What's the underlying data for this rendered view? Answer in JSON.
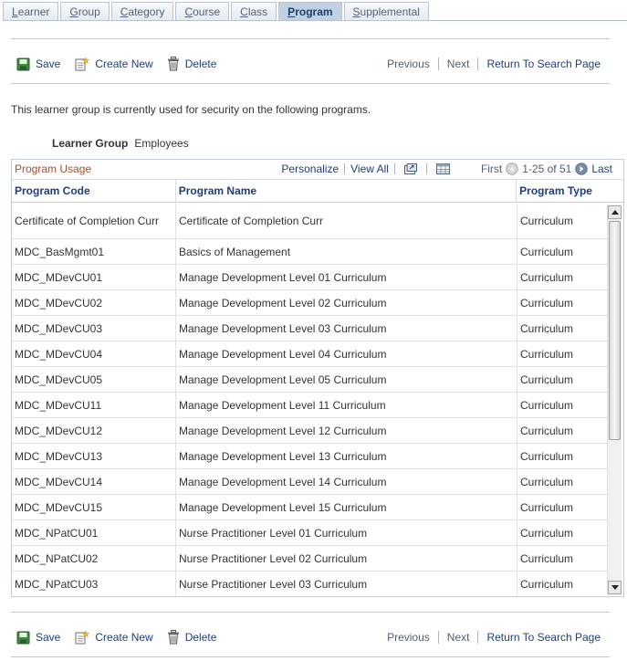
{
  "tabs": [
    {
      "label": "Learner",
      "active": false
    },
    {
      "label": "Group",
      "active": false
    },
    {
      "label": "Category",
      "active": false
    },
    {
      "label": "Course",
      "active": false
    },
    {
      "label": "Class",
      "active": false
    },
    {
      "label": "Program",
      "active": true
    },
    {
      "label": "Supplemental",
      "active": false
    }
  ],
  "toolbar": {
    "save_label": "Save",
    "create_new_label": "Create New",
    "delete_label": "Delete",
    "previous_label": "Previous",
    "next_label": "Next",
    "return_label": "Return To Search Page"
  },
  "info_text": "This learner group is currently used for security on the following programs.",
  "learner_group": {
    "label": "Learner Group",
    "value": "Employees"
  },
  "grid": {
    "title": "Program Usage",
    "personalize_label": "Personalize",
    "view_all_label": "View All",
    "first_label": "First",
    "range_label": "1-25 of 51",
    "last_label": "Last",
    "columns": [
      "Program Code",
      "Program Name",
      "Program Type"
    ],
    "rows": [
      {
        "code": "Certificate of Completion Curr",
        "name": "Certificate of Completion Curr",
        "type": "Curriculum"
      },
      {
        "code": "MDC_BasMgmt01",
        "name": "Basics of Management",
        "type": "Curriculum"
      },
      {
        "code": "MDC_MDevCU01",
        "name": "Manage Development  Level 01 Curriculum",
        "type": "Curriculum"
      },
      {
        "code": "MDC_MDevCU02",
        "name": "Manage Development  Level 02 Curriculum",
        "type": "Curriculum"
      },
      {
        "code": "MDC_MDevCU03",
        "name": "Manage Development  Level 03 Curriculum",
        "type": "Curriculum"
      },
      {
        "code": "MDC_MDevCU04",
        "name": "Manage Development  Level 04 Curriculum",
        "type": "Curriculum"
      },
      {
        "code": "MDC_MDevCU05",
        "name": "Manage Development  Level 05 Curriculum",
        "type": "Curriculum"
      },
      {
        "code": "MDC_MDevCU11",
        "name": "Manage Development  Level 11 Curriculum",
        "type": "Curriculum"
      },
      {
        "code": "MDC_MDevCU12",
        "name": "Manage Development  Level 12 Curriculum",
        "type": "Curriculum"
      },
      {
        "code": "MDC_MDevCU13",
        "name": "Manage Development  Level 13 Curriculum",
        "type": "Curriculum"
      },
      {
        "code": "MDC_MDevCU14",
        "name": "Manage Development  Level 14 Curriculum",
        "type": "Curriculum"
      },
      {
        "code": "MDC_MDevCU15",
        "name": "Manage Development  Level 15 Curriculum",
        "type": "Curriculum"
      },
      {
        "code": "MDC_NPatCU01",
        "name": "Nurse Practitioner Level 01 Curriculum",
        "type": "Curriculum"
      },
      {
        "code": "MDC_NPatCU02",
        "name": "Nurse Practitioner Level 02 Curriculum",
        "type": "Curriculum"
      },
      {
        "code": "MDC_NPatCU03",
        "name": "Nurse Practitioner Level 03 Curriculum",
        "type": "Curriculum"
      }
    ]
  },
  "icons": {
    "save": "floppy-disk-icon",
    "create_new": "new-document-icon",
    "delete": "trash-can-icon",
    "zoom": "new-window-icon",
    "download": "spreadsheet-icon",
    "prev": "left-arrow-icon",
    "next": "right-arrow-icon"
  },
  "colors": {
    "link": "#1f3e7a",
    "grid_title": "#a0522d",
    "active_tab": "#bfd1e3"
  }
}
